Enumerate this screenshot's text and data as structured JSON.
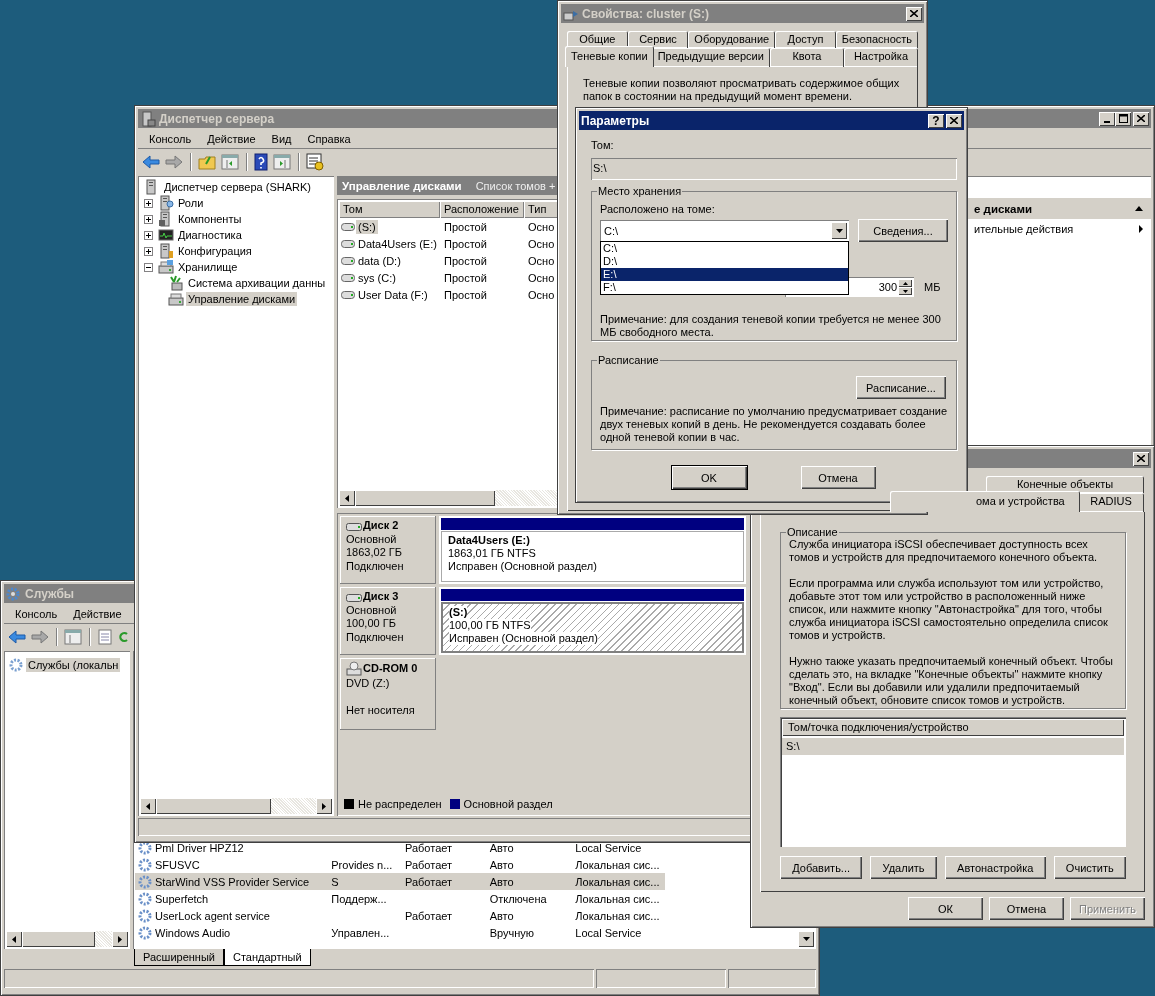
{
  "services_window": {
    "title": "Службы",
    "active": false,
    "menu": [
      "Консоль",
      "Действие"
    ],
    "tree": [
      {
        "label": "Службы (локальн",
        "selected": true
      }
    ],
    "rows": [
      {
        "name": "Pml Driver HPZ12",
        "description": "",
        "status": "Работает",
        "startup": "Авто",
        "logon": "Local Service",
        "selected": false
      },
      {
        "name": "SFUSVC",
        "description": "Provides n...",
        "status": "Работает",
        "startup": "Авто",
        "logon": "Локальная сис...",
        "selected": false
      },
      {
        "name": "StarWind VSS Provider Service",
        "description": "S",
        "status": "Работает",
        "startup": "Авто",
        "logon": "Локальная сис...",
        "selected": true
      },
      {
        "name": "Superfetch",
        "description": "Поддерж...",
        "status": "",
        "startup": "Отключена",
        "logon": "Локальная сис...",
        "selected": false
      },
      {
        "name": "UserLock agent service",
        "description": "",
        "status": "Работает",
        "startup": "Авто",
        "logon": "Локальная сис...",
        "selected": false
      },
      {
        "name": "Windows Audio",
        "description": "Управлен...",
        "status": "",
        "startup": "Вручную",
        "logon": "Local Service",
        "selected": false
      }
    ],
    "tabs": [
      {
        "label": "Расширенный",
        "selected": false
      },
      {
        "label": "Стандартный",
        "selected": true
      }
    ]
  },
  "server_manager": {
    "title": "Диспетчер сервера",
    "active": false,
    "menu": [
      "Консоль",
      "Действие",
      "Вид",
      "Справка"
    ],
    "tree": {
      "label": "Диспетчер сервера (SHARK)",
      "kind": "server",
      "selected": false,
      "children": [
        {
          "label": "Роли",
          "kind": "roles",
          "expanded": false,
          "selected": false
        },
        {
          "label": "Компоненты",
          "kind": "components",
          "expanded": false,
          "selected": false
        },
        {
          "label": "Диагностика",
          "kind": "diagnostics",
          "expanded": false,
          "selected": false
        },
        {
          "label": "Конфигурация",
          "kind": "config",
          "expanded": false,
          "selected": false
        },
        {
          "label": "Хранилище",
          "kind": "storage",
          "expanded": true,
          "selected": false,
          "children": [
            {
              "label": "Система архивации данны",
              "kind": "backup",
              "selected": false
            },
            {
              "label": "Управление дисками",
              "kind": "disks",
              "selected": true
            }
          ]
        }
      ]
    },
    "center": {
      "title": "Управление дисками",
      "subtitle": "Список томов +",
      "columns": [
        "Том",
        "Расположение",
        "Тип"
      ],
      "rows": [
        {
          "volume": "(S:)",
          "layout": "Простой",
          "type": "Осно",
          "selected": true
        },
        {
          "volume": "Data4Users (E:)",
          "layout": "Простой",
          "type": "Осно",
          "selected": false
        },
        {
          "volume": "data (D:)",
          "layout": "Простой",
          "type": "Осно",
          "selected": false
        },
        {
          "volume": "sys (C:)",
          "layout": "Простой",
          "type": "Осно",
          "selected": false
        },
        {
          "volume": "User Data (F:)",
          "layout": "Простой",
          "type": "Осно",
          "selected": false
        }
      ],
      "disks": [
        {
          "kind": "disk",
          "name": "Диск 2",
          "lines": [
            "Основной",
            "1863,02 ГБ",
            "Подключен"
          ],
          "partition": {
            "name": "Data4Users  (E:)",
            "size": "1863,01 ГБ NTFS",
            "status": "Исправен (Основной раздел)",
            "selected": false
          }
        },
        {
          "kind": "disk",
          "name": "Диск 3",
          "lines": [
            "Основной",
            "100,00 ГБ",
            "Подключен"
          ],
          "partition": {
            "name": "(S:)",
            "size": "100,00 ГБ NTFS",
            "status": "Исправен (Основной раздел)",
            "selected": true
          }
        },
        {
          "kind": "cdrom",
          "name": "CD-ROM 0",
          "lines": [
            "DVD (Z:)",
            "Нет носителя"
          ]
        }
      ],
      "legend": [
        {
          "label": "Не распределен",
          "color": "#000000"
        },
        {
          "label": "Основной раздел",
          "color": "#000080"
        }
      ]
    },
    "actions": {
      "header": "е дисками",
      "items": [
        "ительные действия"
      ]
    }
  },
  "properties_window": {
    "title": "Свойства: cluster (S:)",
    "active": false,
    "tab_rows": [
      [
        {
          "label": "Общие",
          "selected": false
        },
        {
          "label": "Сервис",
          "selected": false
        },
        {
          "label": "Оборудование",
          "selected": false
        },
        {
          "label": "Доступ",
          "selected": false
        },
        {
          "label": "Безопасность",
          "selected": false
        }
      ],
      [
        {
          "label": "Теневые копии",
          "selected": true
        },
        {
          "label": "Предыдущие версии",
          "selected": false
        },
        {
          "label": "Квота",
          "selected": false
        },
        {
          "label": "Настройка",
          "selected": false
        }
      ]
    ],
    "intro": "Теневые копии позволяют просматривать содержимое общих папок в состоянии на предыдущий момент времени."
  },
  "params_dialog": {
    "title": "Параметры",
    "active": true,
    "help_button": "?",
    "volume_label": "Том:",
    "volume_value": "S:\\",
    "storage": {
      "legend": "Место хранения",
      "located_label": "Расположено на томе:",
      "combo_value": "C:\\",
      "details_button": "Сведения...",
      "dropdown": [
        {
          "label": "C:\\",
          "selected": false
        },
        {
          "label": "D:\\",
          "selected": false
        },
        {
          "label": "E:\\",
          "selected": true
        },
        {
          "label": "F:\\",
          "selected": false
        }
      ],
      "size_value": "300",
      "size_unit": "МБ",
      "note": "Примечание: для создания теневой копии требуется не менее 300 МБ свободного места."
    },
    "schedule": {
      "legend": "Расписание",
      "button": "Расписание...",
      "note": "Примечание: расписание по умолчанию предусматривает создание двух теневых копий в день. Не рекомендуется создавать более одной теневой копии в час."
    },
    "buttons": [
      {
        "label": "OK",
        "default": true
      },
      {
        "label": "Отмена",
        "default": false
      }
    ]
  },
  "iscsi_window": {
    "active": false,
    "tab_rows": [
      [
        {
          "label": "Конечные объекты",
          "selected": false
        }
      ],
      [
        {
          "label": "ома и устройства",
          "selected": true
        },
        {
          "label": "RADIUS",
          "selected": false
        }
      ]
    ],
    "description": {
      "legend": "Описание",
      "paragraphs": [
        "Служба инициатора iSCSI обеспечивает доступность всех томов и устройств для предпочитаемого конечного объекта.",
        "Если программа или служба используют том или устройство, добавьте этот том или устройство в расположенный ниже список, или нажмите кнопку \"Автонастройка\" для того, чтобы служба инициатора iSCSI самостоятельно определила список томов и устройств.",
        "Нужно также указать предпочитаемый конечный объект. Чтобы сделать это, на вкладке \"Конечные объекты\" нажмите кнопку \"Вход\". Если вы добавили или удалили предпочитаемый конечный объект, обновите список томов и устройств."
      ]
    },
    "list": {
      "column": "Том/точка подключения/устройство",
      "rows": [
        {
          "label": "S:\\",
          "selected": true
        }
      ]
    },
    "buttons": [
      "Добавить...",
      "Удалить",
      "Автонастройка",
      "Очистить"
    ],
    "dialog_buttons": [
      {
        "label": "ОК",
        "disabled": false
      },
      {
        "label": "Отмена",
        "disabled": false
      },
      {
        "label": "Применить",
        "disabled": true
      }
    ]
  }
}
